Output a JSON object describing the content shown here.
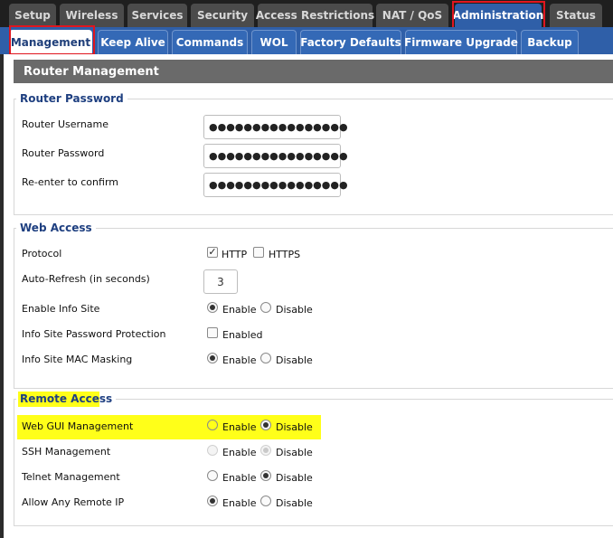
{
  "top_tabs": [
    "Setup",
    "Wireless",
    "Services",
    "Security",
    "Access Restrictions",
    "NAT / QoS",
    "Administration",
    "Status"
  ],
  "sub_tabs": [
    "Management",
    "Keep Alive",
    "Commands",
    "WOL",
    "Factory Defaults",
    "Firmware Upgrade",
    "Backup"
  ],
  "page": {
    "title": "Router Management"
  },
  "router_password": {
    "legend": "Router Password",
    "username_label": "Router Username",
    "username_value": "●●●●●●●●●●●●●●●●",
    "password_label": "Router Password",
    "password_value": "●●●●●●●●●●●●●●●●",
    "confirm_label": "Re-enter to confirm",
    "confirm_value": "●●●●●●●●●●●●●●●●"
  },
  "web_access": {
    "legend": "Web Access",
    "protocol_label": "Protocol",
    "http_label": "HTTP",
    "http_checked": true,
    "https_label": "HTTPS",
    "https_checked": false,
    "refresh_label": "Auto-Refresh (in seconds)",
    "refresh_value": "3",
    "info_site_label": "Enable Info Site",
    "info_site_value": "Enable",
    "info_pw_label": "Info Site Password Protection",
    "info_pw_option": "Enabled",
    "info_pw_checked": false,
    "mac_mask_label": "Info Site MAC Masking",
    "mac_mask_value": "Enable"
  },
  "remote_access": {
    "legend": "Remote Access",
    "webgui_label": "Web GUI Management",
    "webgui_value": "Disable",
    "ssh_label": "SSH Management",
    "ssh_value": "Disable",
    "ssh_disabled": true,
    "telnet_label": "Telnet Management",
    "telnet_value": "Disable",
    "anyip_label": "Allow Any Remote IP",
    "anyip_value": "Enable"
  },
  "options": {
    "enable": "Enable",
    "disable": "Disable"
  },
  "colors": {
    "tab_active": "#2f5fa8",
    "subtab_bar": "#2f5fa8",
    "annotation_red": "#e0161f",
    "highlight_yellow": "#ffff19",
    "legend_text": "#1e3f80"
  }
}
